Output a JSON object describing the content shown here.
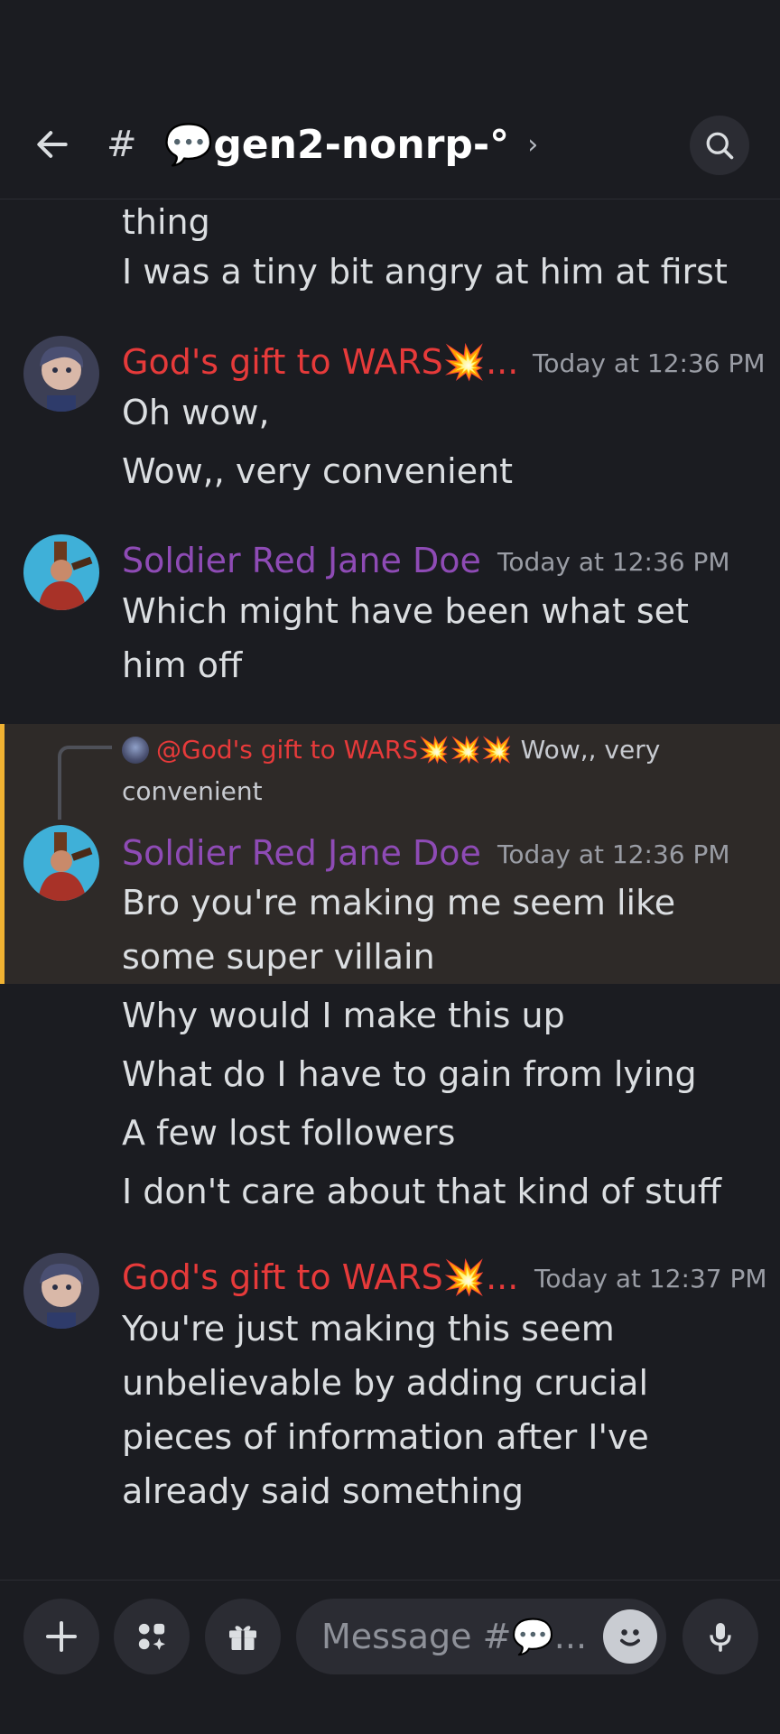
{
  "header": {
    "hash": "#",
    "channel_emoji": "💬",
    "channel_name": "gen2-nonrp-°",
    "chevron": "›"
  },
  "messages": {
    "top_lines": [
      "thing",
      "I was a tiny bit angry at him at first"
    ],
    "m1": {
      "username": "God's gift to WARS💥...",
      "timestamp": "Today at 12:36 PM",
      "lines": [
        "Oh wow,",
        "Wow,, very convenient"
      ]
    },
    "m2": {
      "username": "Soldier Red Jane Doe",
      "timestamp": "Today at 12:36 PM",
      "text": "Which might have been what set him off"
    },
    "reply": {
      "mention": "@God's gift to WARS💥💥💥",
      "text": "Wow,, very convenient"
    },
    "m3": {
      "username": "Soldier Red Jane Doe",
      "timestamp": "Today at 12:36 PM",
      "text": "Bro you're making me seem like some super villain",
      "lines": [
        "Why would I make this up",
        "What do I have to gain from lying",
        "A few lost followers",
        "I don't care about that kind of stuff"
      ]
    },
    "m4": {
      "username": "God's gift to WARS💥...",
      "timestamp": "Today at 12:37 PM",
      "text": "You're just making this seem unbelievable by adding crucial pieces of information after I've already said something"
    }
  },
  "composer": {
    "placeholder": "Message #💬..."
  },
  "icons": {
    "back": "arrow-left-icon",
    "search": "search-icon",
    "add": "plus-icon",
    "apps": "apps-icon",
    "gift": "gift-icon",
    "emoji": "emoji-icon",
    "mic": "microphone-icon"
  },
  "colors": {
    "background": "#1b1c21",
    "red_name": "#e63a3a",
    "purple_name": "#8e4bb5",
    "highlight_bg": "#2e2a28",
    "highlight_bar": "#f0b232",
    "timestamp": "#9a9da5"
  }
}
